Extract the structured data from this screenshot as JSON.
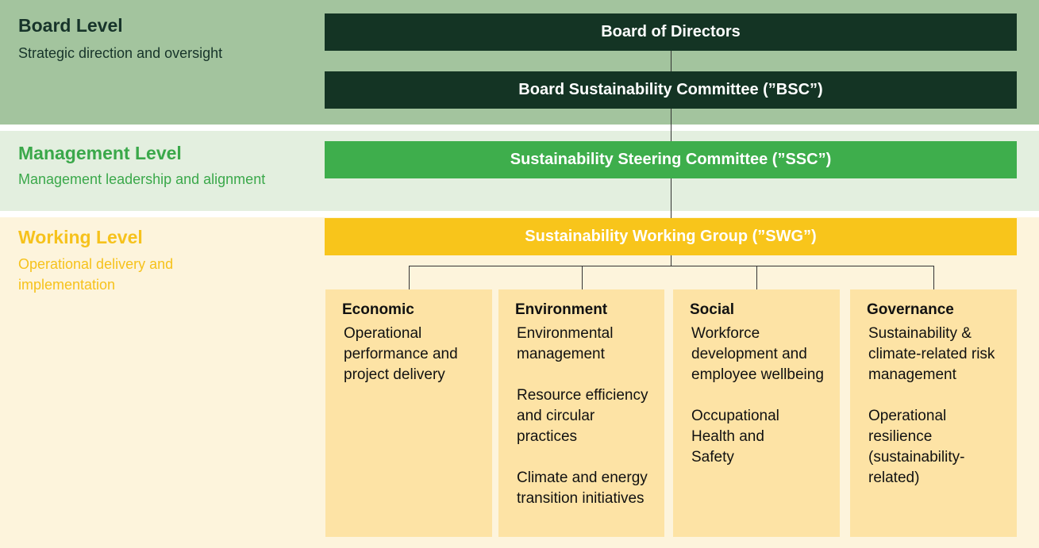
{
  "levels": {
    "board": {
      "title": "Board Level",
      "subtitle": "Strategic direction and oversight"
    },
    "management": {
      "title": "Management Level",
      "subtitle": "Management leadership and alignment"
    },
    "working": {
      "title": "Working Level",
      "subtitle": "Operational delivery and implementation"
    }
  },
  "bodies": {
    "bod": "Board of Directors",
    "bsc": "Board Sustainability Committee (”BSC”)",
    "ssc": "Sustainability Steering Committee (”SSC”)",
    "swg": "Sustainability Working Group (”SWG”)"
  },
  "pillars": [
    {
      "title": "Economic",
      "items": [
        "Operational performance and project delivery"
      ]
    },
    {
      "title": "Environment",
      "items": [
        "Environmental management",
        "Resource efficiency and circular practices",
        "Climate and energy transition initiatives"
      ]
    },
    {
      "title": "Social",
      "items": [
        "Workforce development and employee wellbeing",
        "Occupational Health and Safety"
      ]
    },
    {
      "title": "Governance",
      "items": [
        "Sustainability & climate-related risk management",
        "Operational resilience (sustainability-related)"
      ]
    }
  ],
  "colors": {
    "board_band": "#a3c49e",
    "management_band": "#e3efdf",
    "working_band": "#fdf4dc",
    "board_bar": "#143424",
    "management_bar": "#3eae4c",
    "working_bar": "#f8c51b",
    "pillar_card": "#fde3a5"
  }
}
